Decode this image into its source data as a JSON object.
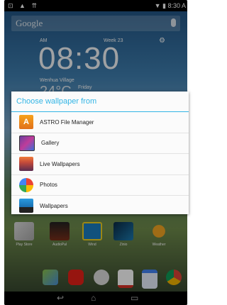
{
  "status": {
    "left_icons": "⊡ ▲ ⇈",
    "right": "▼ ▮ 8:30 A"
  },
  "search": {
    "label": "Google"
  },
  "clock": {
    "ampm": "AM",
    "week": "Week 23",
    "time": "08:30",
    "location": "Wenhua Village",
    "temp": "24°C",
    "day": "Friday"
  },
  "dialog": {
    "title": "Choose wallpaper from",
    "options": [
      {
        "label": "ASTRO File Manager",
        "icon": "astro-icon"
      },
      {
        "label": "Gallery",
        "icon": "gallery-icon"
      },
      {
        "label": "Live Wallpapers",
        "icon": "live-wallpapers-icon"
      },
      {
        "label": "Photos",
        "icon": "photos-icon"
      },
      {
        "label": "Wallpapers",
        "icon": "wallpapers-icon"
      }
    ]
  },
  "apps": [
    {
      "label": "Play Store"
    },
    {
      "label": "AudioPal"
    },
    {
      "label": "Wind"
    },
    {
      "label": "Zinio"
    },
    {
      "label": "Weather"
    }
  ],
  "colors": {
    "accent": "#33b5e5"
  }
}
